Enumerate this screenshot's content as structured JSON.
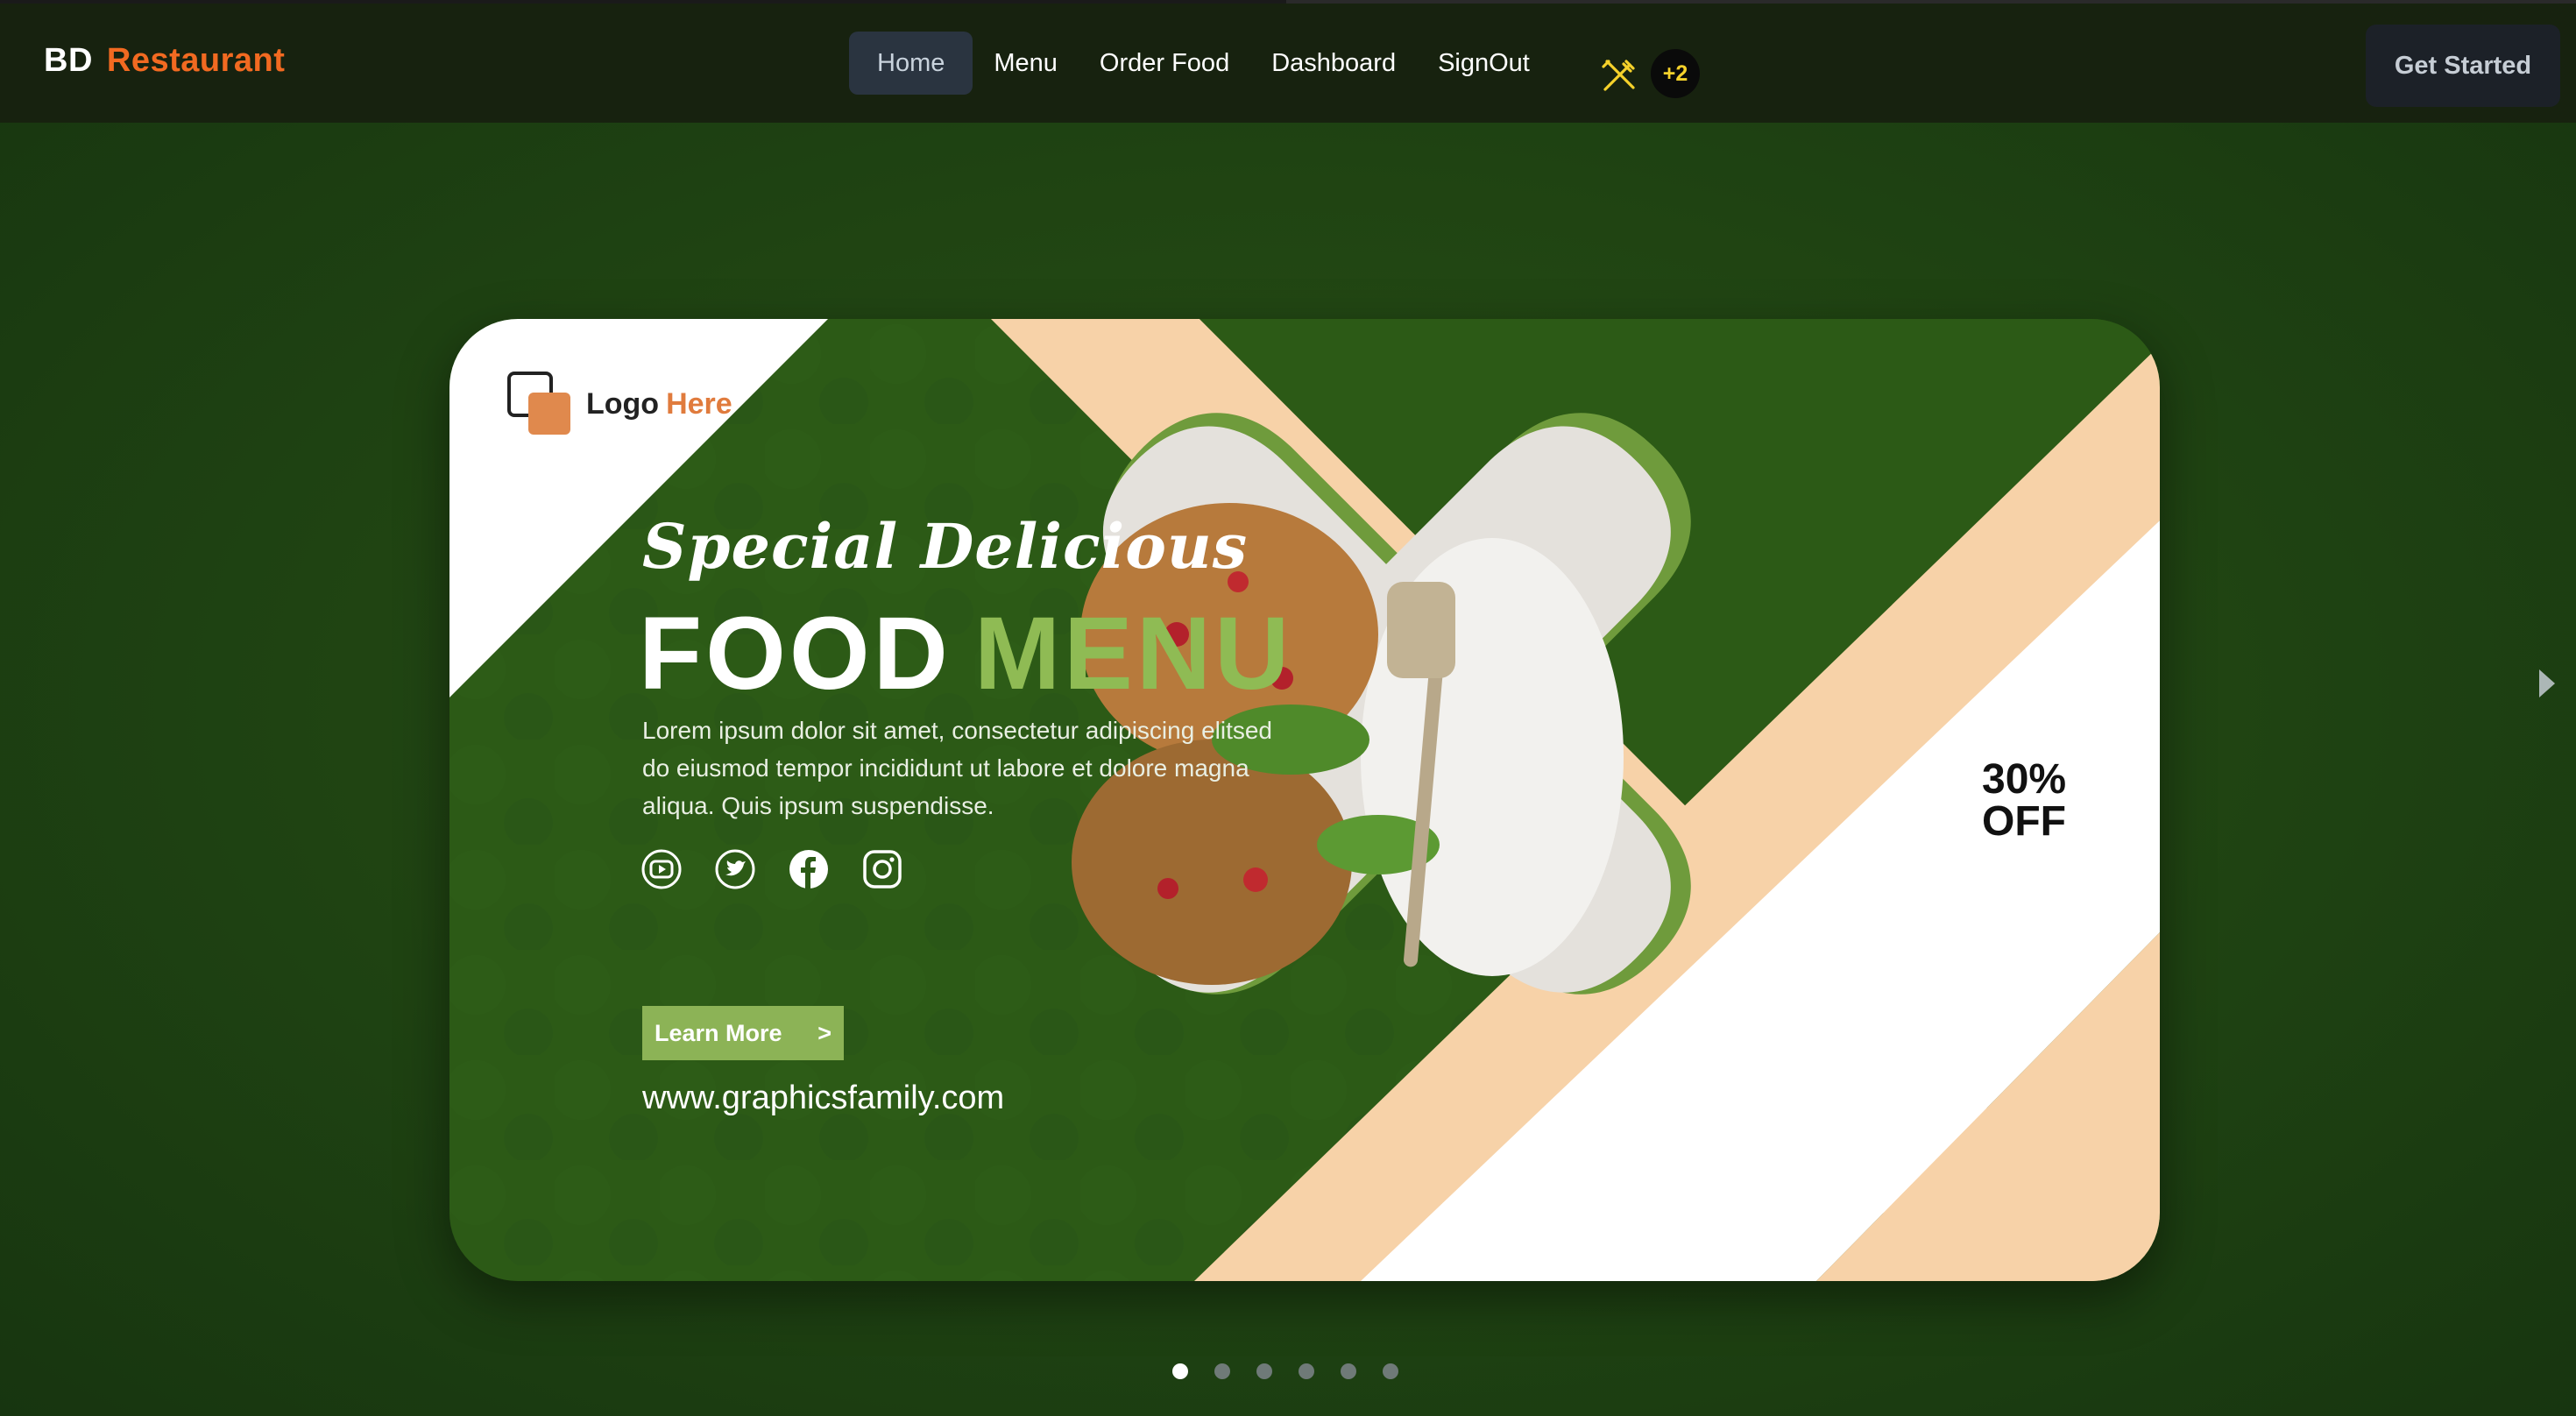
{
  "brand": {
    "prefix": "BD",
    "name": "Restaurant"
  },
  "nav": {
    "items": [
      {
        "label": "Home",
        "active": true
      },
      {
        "label": "Menu"
      },
      {
        "label": "Order Food"
      },
      {
        "label": "Dashboard"
      },
      {
        "label": "SignOut"
      }
    ],
    "cart_icon": "utensils-icon",
    "cart_badge": "+2"
  },
  "cta": {
    "label": "Get Started"
  },
  "banner": {
    "logo_text": "Logo",
    "logo_accent": "Here",
    "script_title": "Special Delicious",
    "title_part1": "FOOD",
    "title_part2": "MENU",
    "description": "Lorem ipsum dolor sit amet, consectetur adipiscing elitsed do eiusmod tempor incididunt ut labore et dolore magna aliqua. Quis ipsum suspendisse.",
    "social_icons": [
      "youtube-icon",
      "twitter-icon",
      "facebook-icon",
      "instagram-icon"
    ],
    "button_label": "Learn More",
    "button_chevron": ">",
    "website": "www.graphicsfamily.com",
    "discount_line1": "30%",
    "discount_line2": "OFF"
  },
  "carousel": {
    "slides": 6,
    "active_index": 0
  },
  "colors": {
    "accent": "#f26a21",
    "banner_green": "#2c5a16",
    "menu_green": "#8fbb54",
    "peach": "#f7d2a8",
    "badge_yellow": "#f6d22b"
  }
}
